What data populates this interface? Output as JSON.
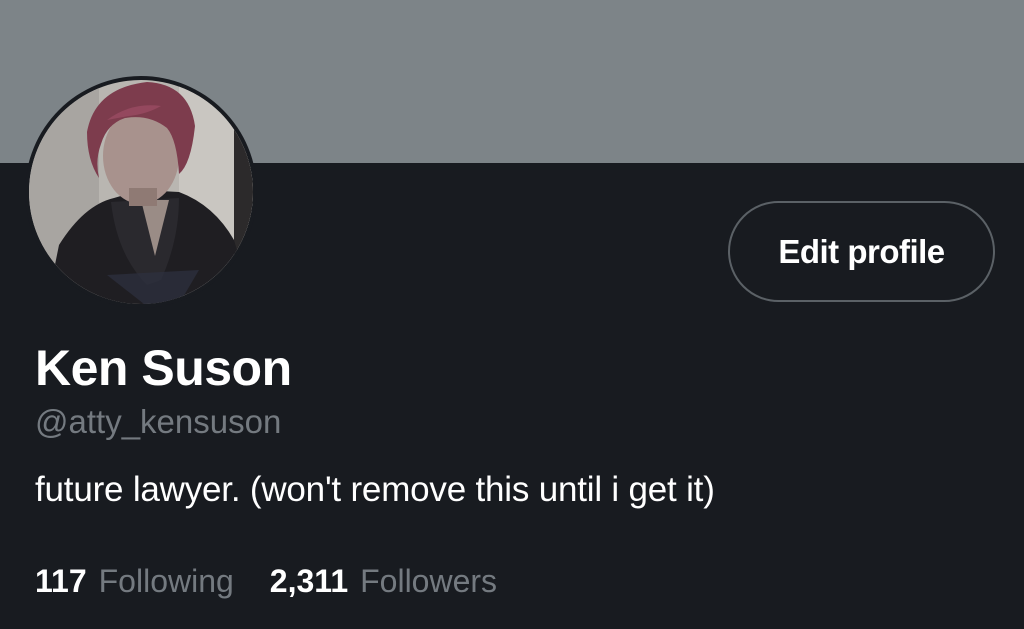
{
  "profile": {
    "display_name": "Ken Suson",
    "handle": "@atty_kensuson",
    "bio": "future lawyer. (won't remove this until i get it)",
    "edit_button_label": "Edit profile"
  },
  "stats": {
    "following_count": "117",
    "following_label": "Following",
    "followers_count": "2,311",
    "followers_label": "Followers"
  },
  "colors": {
    "background": "#181b20",
    "banner": "#7d8488",
    "secondary_text": "#747a80",
    "button_border": "#5b6166"
  }
}
